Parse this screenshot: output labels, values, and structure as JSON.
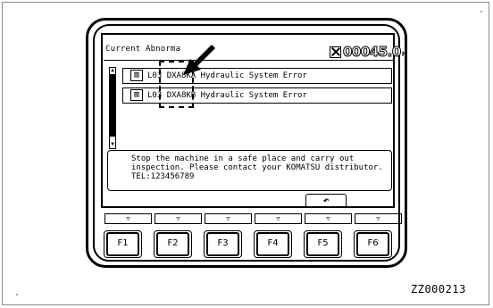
{
  "screen": {
    "title": "Current Abnorma",
    "hourmeter_value": "00045.0",
    "hourmeter_unit": "h"
  },
  "errors": [
    {
      "level": "L03",
      "code": "DXA8KA",
      "description": "Hydraulic System Error",
      "icon": "machine-icon"
    },
    {
      "level": "L03",
      "code": "DXA8KB",
      "description": "Hydraulic System Error",
      "icon": "machine-icon"
    }
  ],
  "message": {
    "line1": "Stop the machine in a safe place and carry out",
    "line2": "inspection. Please contact your KOMATSU distributor.",
    "line3": "TEL:123456789"
  },
  "function_keys": [
    "F1",
    "F2",
    "F3",
    "F4",
    "F5",
    "F6"
  ],
  "guide_icon": "▽",
  "back_icon": "↶",
  "figure_code": "ZZ000213"
}
